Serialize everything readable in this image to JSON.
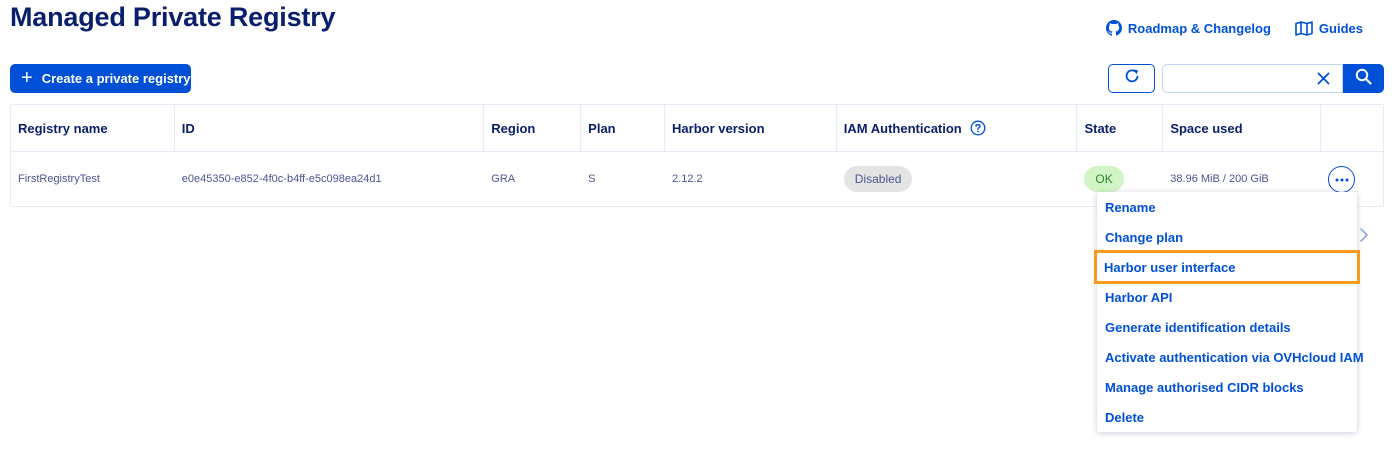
{
  "page": {
    "title": "Managed Private Registry"
  },
  "top_links": {
    "roadmap_label": "Roadmap & Changelog",
    "guides_label": "Guides"
  },
  "toolbar": {
    "create_label": "Create a private registry",
    "search_value": "",
    "search_placeholder": ""
  },
  "table": {
    "headers": {
      "registry_name": "Registry name",
      "id": "ID",
      "region": "Region",
      "plan": "Plan",
      "harbor_version": "Harbor version",
      "iam_auth": "IAM Authentication",
      "state": "State",
      "space_used": "Space used"
    },
    "rows": [
      {
        "registry_name": "FirstRegistryTest",
        "id": "e0e45350-e852-4f0c-b4ff-e5c098ea24d1",
        "region": "GRA",
        "plan": "S",
        "harbor_version": "2.12.2",
        "iam_auth": "Disabled",
        "state": "OK",
        "space_used": "38.96 MiB / 200 GiB"
      }
    ]
  },
  "menu": {
    "items": [
      "Rename",
      "Change plan",
      "Harbor user interface",
      "Harbor API",
      "Generate identification details",
      "Activate authentication via OVHcloud IAM",
      "Manage authorised CIDR blocks",
      "Delete"
    ],
    "highlighted_index": 2
  },
  "colors": {
    "primary": "#0050d7",
    "title": "#0a1f6b",
    "highlight_outline": "#f89b1c",
    "badge_ok_bg": "#d2f5c8",
    "badge_disabled_bg": "#e4e4e4"
  }
}
